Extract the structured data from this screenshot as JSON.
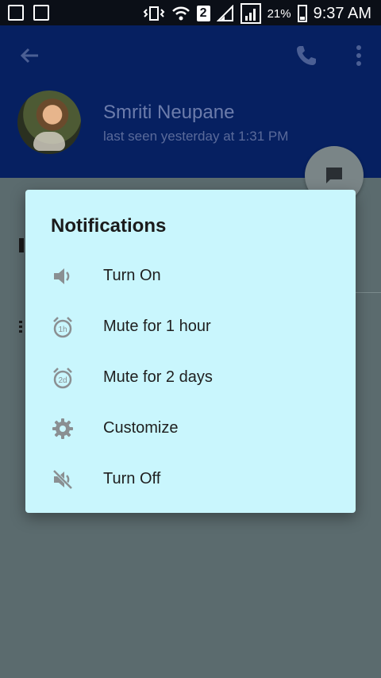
{
  "status_bar": {
    "sim_badge": "2",
    "battery": "21%",
    "time": "9:37 AM"
  },
  "chat_header": {
    "contact_name": "Smriti Neupane",
    "last_seen": "last seen yesterday at 1:31 PM"
  },
  "dialog": {
    "title": "Notifications",
    "items": [
      {
        "label": "Turn On",
        "icon": "volume-on-icon"
      },
      {
        "label": "Mute for 1 hour",
        "icon": "alarm-1h-icon"
      },
      {
        "label": "Mute for 2 days",
        "icon": "alarm-2d-icon"
      },
      {
        "label": "Customize",
        "icon": "gear-icon"
      },
      {
        "label": "Turn Off",
        "icon": "volume-off-icon"
      }
    ]
  },
  "colors": {
    "app_bar": "#062061",
    "dialog_bg": "#c9f6fd",
    "scrim": "#5b6b6e",
    "icon_gray": "#8a8f92"
  }
}
